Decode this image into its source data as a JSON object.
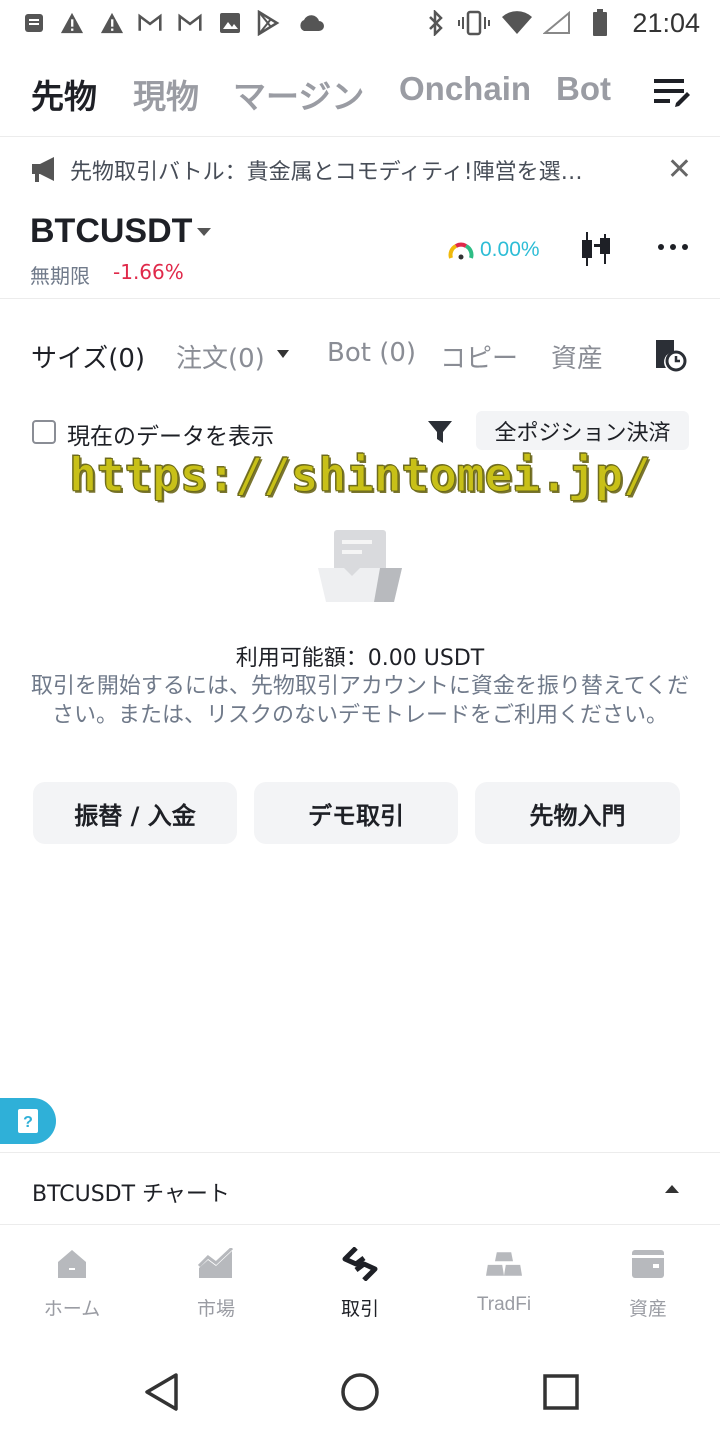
{
  "status_bar": {
    "time": "21:04"
  },
  "top_tabs": [
    "先物",
    "現物",
    "マージン",
    "Onchain",
    "Bot"
  ],
  "banner": {
    "text": "先物取引バトル：貴金属とコモディティ!陣営を選…"
  },
  "pair": {
    "symbol": "BTCUSDT",
    "contract": "無期限",
    "change": "-1.66%",
    "funding": "0.00%"
  },
  "sub_tabs": {
    "size": "サイズ(0)",
    "orders": "注文(0)",
    "bot": "Bot (0)",
    "copy": "コピー",
    "assets": "資産"
  },
  "filter": {
    "show_current": "現在のデータを表示",
    "close_all": "全ポジション決済"
  },
  "watermark": "https://shintomei.jp/",
  "empty": {
    "available": "利用可能額：0.00 USDT",
    "description": "取引を開始するには、先物取引アカウントに資金を振り替えてください。または、リスクのないデモトレードをご利用ください。"
  },
  "actions": {
    "transfer": "振替 / 入金",
    "demo": "デモ取引",
    "intro": "先物入門"
  },
  "chart_bar": {
    "label": "BTCUSDT チャート"
  },
  "bottom_nav": {
    "home": "ホーム",
    "market": "市場",
    "trade": "取引",
    "tradfi": "TradFi",
    "assets": "資産"
  },
  "colors": {
    "negative": "#e0294a",
    "funding": "#2ebdd6",
    "help_fab": "#2fb0d8",
    "watermark": "#c8c018"
  }
}
